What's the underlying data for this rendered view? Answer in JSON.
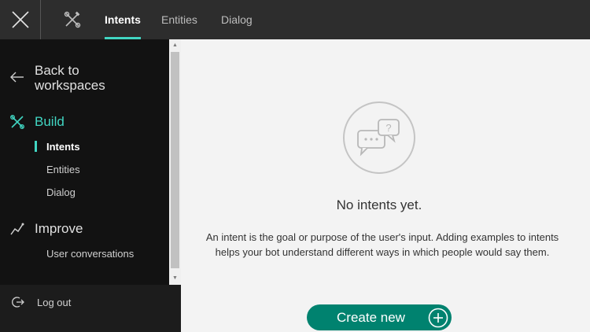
{
  "topbar": {
    "close_icon": "close-icon",
    "tools_icon": "tools-icon",
    "tabs": [
      {
        "label": "Intents",
        "active": true
      },
      {
        "label": "Entities",
        "active": false
      },
      {
        "label": "Dialog",
        "active": false
      }
    ]
  },
  "sidebar": {
    "back_label": "Back to workspaces",
    "build": {
      "label": "Build",
      "items": [
        {
          "label": "Intents",
          "active": true
        },
        {
          "label": "Entities",
          "active": false
        },
        {
          "label": "Dialog",
          "active": false
        }
      ]
    },
    "improve": {
      "label": "Improve",
      "items": [
        {
          "label": "User conversations"
        }
      ]
    },
    "logout_label": "Log out"
  },
  "main": {
    "empty_title": "No intents yet.",
    "empty_description": "An intent is the goal or purpose of the user's input. Adding examples to intents helps your bot understand different ways in which people would say them.",
    "create_label": "Create new"
  },
  "colors": {
    "accent": "#41d6c3",
    "button": "#00826f",
    "topbar": "#2d2d2d",
    "sidebar": "#121212"
  }
}
